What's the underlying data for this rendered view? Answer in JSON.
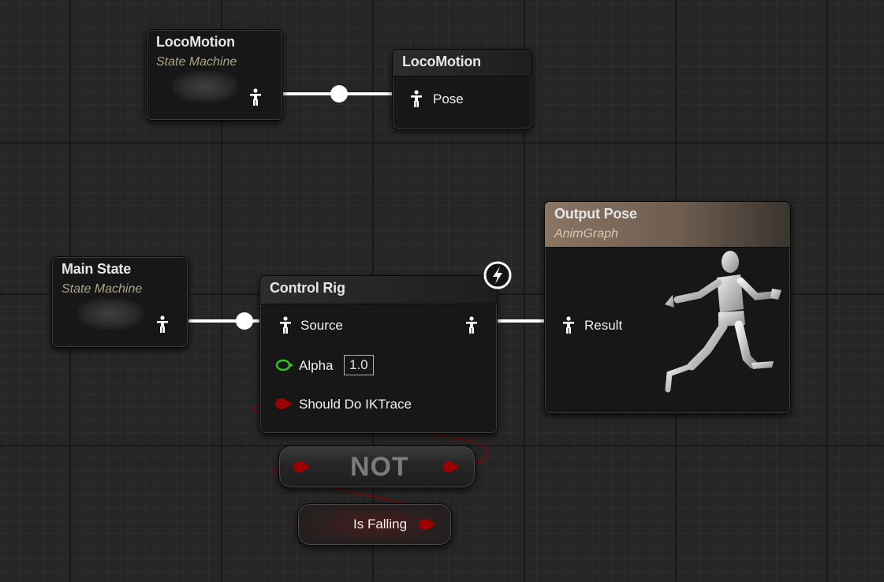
{
  "nodes": {
    "locomotion_sm": {
      "title": "LocoMotion",
      "subtitle": "State Machine"
    },
    "locomotion_pose": {
      "title": "LocoMotion",
      "pin": "Pose"
    },
    "main_state": {
      "title": "Main State",
      "subtitle": "State Machine"
    },
    "control_rig": {
      "title": "Control Rig",
      "source": "Source",
      "alpha": "Alpha",
      "alpha_value": "1.0",
      "ik_trace": "Should Do IKTrace"
    },
    "output_pose": {
      "title": "Output Pose",
      "subtitle": "AnimGraph",
      "result": "Result"
    },
    "not_node": {
      "label": "NOT"
    },
    "is_falling": {
      "label": "Is Falling"
    }
  },
  "colors": {
    "exec_wire": "#ffffff",
    "bool_pin": "#9d0000",
    "float_pin": "#35c02a",
    "output_header": "#8a7563"
  },
  "icons": [
    "pose-pin-icon",
    "lightning-icon",
    "mannequin-preview-icon"
  ]
}
